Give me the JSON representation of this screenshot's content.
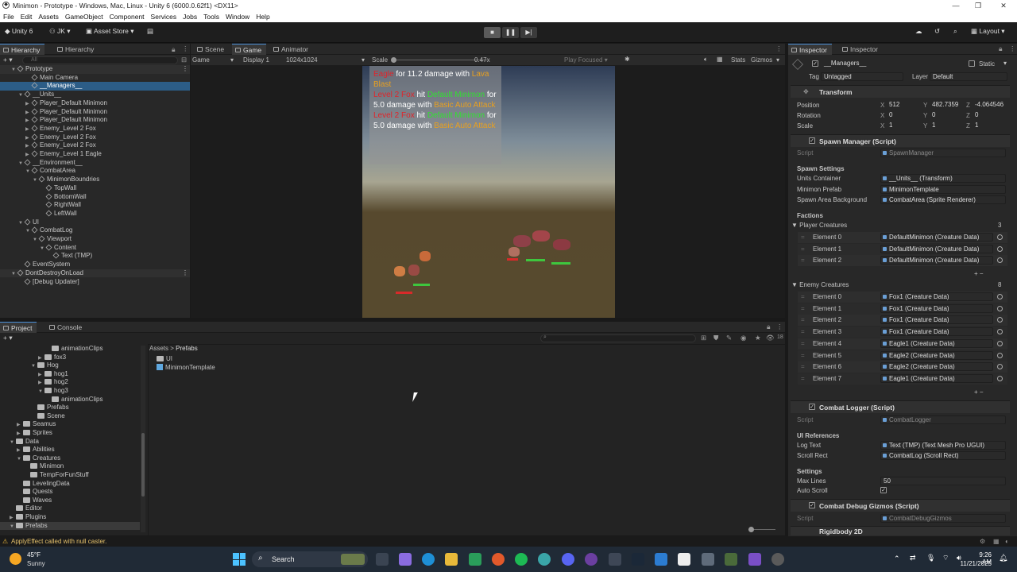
{
  "window": {
    "title": "Minimon - Prototype - Windows, Mac, Linux - Unity 6 (6000.0.62f1) <DX11>"
  },
  "menu": [
    "File",
    "Edit",
    "Assets",
    "GameObject",
    "Component",
    "Services",
    "Jobs",
    "Tools",
    "Window",
    "Help"
  ],
  "toolbar": {
    "unity_label": "Unity 6",
    "account": "JK",
    "asset_store": "Asset Store",
    "layout": "Layout"
  },
  "hierarchy": {
    "tabs": [
      "Hierarchy",
      "Hierarchy"
    ],
    "search_placeholder": "All",
    "rows": [
      {
        "label": "Prototype",
        "indent": 0,
        "arrow": "▼",
        "scene": true
      },
      {
        "label": "Main Camera",
        "indent": 2
      },
      {
        "label": "__Managers__",
        "indent": 2,
        "selected": true
      },
      {
        "label": "__Units__",
        "indent": 1,
        "arrow": "▼"
      },
      {
        "label": "Player_Default Minimon",
        "indent": 2,
        "arrow": "▶"
      },
      {
        "label": "Player_Default Minimon",
        "indent": 2,
        "arrow": "▶"
      },
      {
        "label": "Player_Default Minimon",
        "indent": 2,
        "arrow": "▶"
      },
      {
        "label": "Enemy_Level 2 Fox",
        "indent": 2,
        "arrow": "▶"
      },
      {
        "label": "Enemy_Level 2 Fox",
        "indent": 2,
        "arrow": "▶"
      },
      {
        "label": "Enemy_Level 2 Fox",
        "indent": 2,
        "arrow": "▶"
      },
      {
        "label": "Enemy_Level 1 Eagle",
        "indent": 2,
        "arrow": "▶"
      },
      {
        "label": "__Environment__",
        "indent": 1,
        "arrow": "▼"
      },
      {
        "label": "CombatArea",
        "indent": 2,
        "arrow": "▼"
      },
      {
        "label": "MinimonBoundries",
        "indent": 3,
        "arrow": "▼"
      },
      {
        "label": "TopWall",
        "indent": 4
      },
      {
        "label": "BottomWall",
        "indent": 4
      },
      {
        "label": "RightWall",
        "indent": 4
      },
      {
        "label": "LeftWall",
        "indent": 4
      },
      {
        "label": "UI",
        "indent": 1,
        "arrow": "▼"
      },
      {
        "label": "CombatLog",
        "indent": 2,
        "arrow": "▼"
      },
      {
        "label": "Viewport",
        "indent": 3,
        "arrow": "▼"
      },
      {
        "label": "Content",
        "indent": 4,
        "arrow": "▼"
      },
      {
        "label": "Text (TMP)",
        "indent": 5
      },
      {
        "label": "EventSystem",
        "indent": 1
      },
      {
        "label": "DontDestroyOnLoad",
        "indent": 0,
        "arrow": "▼",
        "scene": true
      },
      {
        "label": "[Debug Updater]",
        "indent": 1
      }
    ]
  },
  "scene_tabs": [
    "Scene",
    "Game",
    "Animator"
  ],
  "game_bar": {
    "mode": "Game",
    "display": "Display 1",
    "resolution": "1024x1024",
    "scale_label": "Scale",
    "scale_value": "0.47x",
    "play_focused": "Play Focused",
    "stats": "Stats",
    "gizmos": "Gizmos"
  },
  "combat_log": [
    [
      {
        "t": "Eagle",
        "c": "#e0242a"
      },
      {
        "t": " for 11.2 damage with ",
        "c": "#ffffff"
      },
      {
        "t": "Lava Blast",
        "c": "#e8a020"
      }
    ],
    [
      {
        "t": "Level 2 Fox",
        "c": "#e0242a"
      },
      {
        "t": " hit ",
        "c": "#ffffff"
      },
      {
        "t": "Default Minimon",
        "c": "#32e032"
      },
      {
        "t": " for 5.0 damage with ",
        "c": "#ffffff"
      },
      {
        "t": "Basic Auto Attack",
        "c": "#e8a020"
      }
    ],
    [
      {
        "t": "Level 2 Fox",
        "c": "#e0242a"
      },
      {
        "t": " hit ",
        "c": "#ffffff"
      },
      {
        "t": "Default Minimon",
        "c": "#32e032"
      },
      {
        "t": " for 5.0 damage with ",
        "c": "#ffffff"
      },
      {
        "t": "Basic Auto Attack",
        "c": "#e8a020"
      }
    ]
  ],
  "project": {
    "tabs": [
      "Project",
      "Console"
    ],
    "tree": [
      {
        "label": "animationClips",
        "indent": 5
      },
      {
        "label": "fox3",
        "indent": 4,
        "arrow": "▶"
      },
      {
        "label": "Hog",
        "indent": 3,
        "arrow": "▼"
      },
      {
        "label": "hog1",
        "indent": 4,
        "arrow": "▶"
      },
      {
        "label": "hog2",
        "indent": 4,
        "arrow": "▶"
      },
      {
        "label": "hog3",
        "indent": 4,
        "arrow": "▼"
      },
      {
        "label": "animationClips",
        "indent": 5
      },
      {
        "label": "Prefabs",
        "indent": 3
      },
      {
        "label": "Scene",
        "indent": 3
      },
      {
        "label": "Seamus",
        "indent": 1,
        "arrow": "▶"
      },
      {
        "label": "Sprites",
        "indent": 1,
        "arrow": "▶"
      },
      {
        "label": "Data",
        "indent": 0,
        "arrow": "▼"
      },
      {
        "label": "Abilities",
        "indent": 1,
        "arrow": "▶"
      },
      {
        "label": "Creatures",
        "indent": 1,
        "arrow": "▼"
      },
      {
        "label": "Minimon",
        "indent": 2
      },
      {
        "label": "TempForFunStuff",
        "indent": 2
      },
      {
        "label": "LevelingData",
        "indent": 1
      },
      {
        "label": "Quests",
        "indent": 1
      },
      {
        "label": "Waves",
        "indent": 1
      },
      {
        "label": "Editor",
        "indent": 0
      },
      {
        "label": "Plugins",
        "indent": 0,
        "arrow": "▶"
      },
      {
        "label": "Prefabs",
        "indent": 0,
        "arrow": "▼",
        "selected": true
      }
    ],
    "breadcrumb": [
      "Assets",
      "Prefabs"
    ],
    "assets": [
      {
        "label": "UI",
        "type": "folder"
      },
      {
        "label": "MinimonTemplate",
        "type": "prefab"
      }
    ],
    "count": "18"
  },
  "status": {
    "message": "ApplyEffect called with null caster."
  },
  "inspector": {
    "tabs": [
      "Inspector",
      "Inspector"
    ],
    "object_name": "__Managers__",
    "static": "Static",
    "tag_label": "Tag",
    "tag": "Untagged",
    "layer_label": "Layer",
    "layer": "Default",
    "transform": {
      "title": "Transform",
      "position": {
        "label": "Position",
        "x": "512",
        "y": "482.7359",
        "z": "-4.064546"
      },
      "rotation": {
        "label": "Rotation",
        "x": "0",
        "y": "0",
        "z": "0"
      },
      "scale": {
        "label": "Scale",
        "x": "1",
        "y": "1",
        "z": "1"
      }
    },
    "spawn_manager": {
      "title": "Spawn Manager (Script)",
      "script_label": "Script",
      "script": "SpawnManager",
      "settings_header": "Spawn Settings",
      "units_container_label": "Units Container",
      "units_container": "__Units__ (Transform)",
      "minimon_prefab_label": "Minimon Prefab",
      "minimon_prefab": "MinimonTemplate",
      "spawn_bg_label": "Spawn Area Background",
      "spawn_bg": "CombatArea (Sprite Renderer)",
      "factions_header": "Factions",
      "player_label": "Player Creatures",
      "player_count": "3",
      "player": [
        {
          "label": "Element 0",
          "value": "DefaultMinimon (Creature Data)"
        },
        {
          "label": "Element 1",
          "value": "DefaultMinimon (Creature Data)"
        },
        {
          "label": "Element 2",
          "value": "DefaultMinimon (Creature Data)"
        }
      ],
      "enemy_label": "Enemy Creatures",
      "enemy_count": "8",
      "enemy": [
        {
          "label": "Element 0",
          "value": "Fox1 (Creature Data)"
        },
        {
          "label": "Element 1",
          "value": "Fox1 (Creature Data)"
        },
        {
          "label": "Element 2",
          "value": "Fox1 (Creature Data)"
        },
        {
          "label": "Element 3",
          "value": "Fox1 (Creature Data)"
        },
        {
          "label": "Element 4",
          "value": "Eagle1 (Creature Data)"
        },
        {
          "label": "Element 5",
          "value": "Eagle2 (Creature Data)"
        },
        {
          "label": "Element 6",
          "value": "Eagle2 (Creature Data)"
        },
        {
          "label": "Element 7",
          "value": "Eagle1 (Creature Data)"
        }
      ]
    },
    "combat_logger": {
      "title": "Combat Logger (Script)",
      "script_label": "Script",
      "script": "CombatLogger",
      "ui_header": "UI References",
      "log_text_label": "Log Text",
      "log_text": "Text (TMP) (Text Mesh Pro UGUI)",
      "scroll_rect_label": "Scroll Rect",
      "scroll_rect": "CombatLog (Scroll Rect)",
      "settings_header": "Settings",
      "max_lines_label": "Max Lines",
      "max_lines": "50",
      "auto_scroll_label": "Auto Scroll"
    },
    "gizmos": {
      "title": "Combat Debug Gizmos (Script)",
      "script_label": "Script",
      "script": "CombatDebugGizmos"
    },
    "rigidbody": {
      "title": "Rigidbody 2D"
    }
  },
  "taskbar": {
    "temp": "45°F",
    "weather": "Sunny",
    "search": "Search",
    "time": "9:26 AM",
    "date": "11/21/2025"
  }
}
